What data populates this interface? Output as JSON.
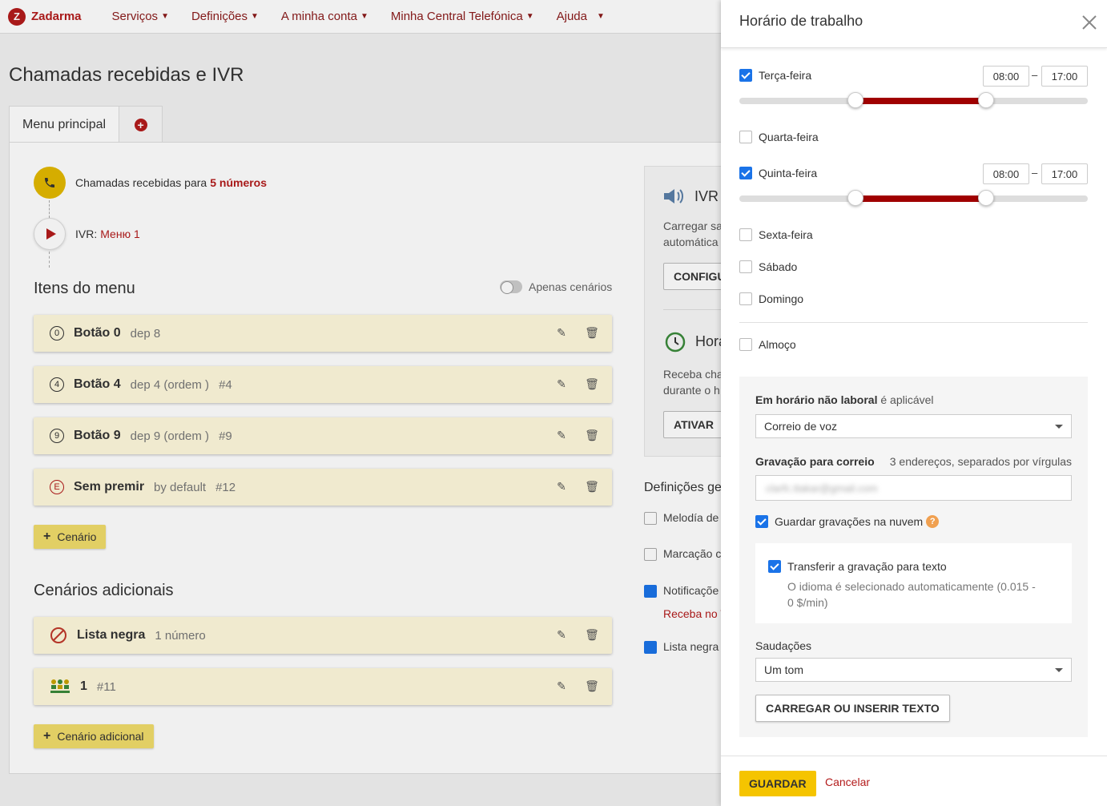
{
  "topbar": {
    "brand": "Zadarma",
    "nav": [
      "Serviços",
      "Definições",
      "A minha conta",
      "Minha Central Telefónica",
      "Ajuda"
    ]
  },
  "page": {
    "title": "Chamadas recebidas e IVR",
    "tab_main": "Menu principal"
  },
  "flow": {
    "incoming_text": "Chamadas recebidas para",
    "incoming_link": "5 números",
    "ivr_label": "IVR:",
    "ivr_link": "Меню 1"
  },
  "menu_section": {
    "title": "Itens do menu",
    "toggle_label": "Apenas cenários",
    "items": [
      {
        "key": "0",
        "name": "Botão 0",
        "sub": "dep 8",
        "num": ""
      },
      {
        "key": "4",
        "name": "Botão 4",
        "sub": "dep 4 (ordem )",
        "num": "#4"
      },
      {
        "key": "9",
        "name": "Botão 9",
        "sub": "dep 9 (ordem )",
        "num": "#9"
      },
      {
        "key": "E",
        "name": "Sem premir",
        "sub": "by default",
        "num": "#12"
      }
    ],
    "add_button": "Cenário"
  },
  "scenarios_section": {
    "title": "Cenários adicionais",
    "items": [
      {
        "name": "Lista negra",
        "sub": "1 número"
      },
      {
        "name": "1",
        "sub": "#11"
      }
    ],
    "add_button": "Cenário adicional"
  },
  "right_card": {
    "ivr_title": "IVR",
    "ivr_text_1": "Carregar sa",
    "ivr_text_2": "automática",
    "ivr_button": "CONFIGU",
    "hours_title": "Hora",
    "hours_text_1": "Receba cha",
    "hours_text_2": "durante o h",
    "hours_button": "ATIVAR"
  },
  "general_settings": {
    "title": "Definições ge",
    "items": [
      {
        "label": "Melodía de",
        "checked": false
      },
      {
        "label": "Marcação c",
        "checked": false
      },
      {
        "label": "Notificaçõe",
        "checked": true
      },
      {
        "label": "Lista negra",
        "checked": true
      }
    ],
    "notify_link": "Receba no T"
  },
  "panel": {
    "title": "Horário de trabalho",
    "days": [
      {
        "name": "Terça-feira",
        "checked": true,
        "start": "08:00",
        "end": "17:00",
        "start_frac": 0.333,
        "end_frac": 0.708
      },
      {
        "name": "Quarta-feira",
        "checked": false
      },
      {
        "name": "Quinta-feira",
        "checked": true,
        "start": "08:00",
        "end": "17:00",
        "start_frac": 0.333,
        "end_frac": 0.708
      },
      {
        "name": "Sexta-feira",
        "checked": false
      },
      {
        "name": "Sábado",
        "checked": false
      },
      {
        "name": "Domingo",
        "checked": false
      }
    ],
    "time_separator": "–",
    "lunch_label": "Almoço",
    "lunch_checked": false,
    "offhours_label_bold": "Em horário não laboral",
    "offhours_label_rest": "é aplicável",
    "offhours_value": "Correio de voz",
    "voicemail_label": "Gravação para correio",
    "voicemail_hint": "3 endereços, separados por vírgulas",
    "voicemail_value": "clarfc.ttakar@gmail.com",
    "cloud_label": "Guardar gravações na nuvem",
    "cloud_checked": true,
    "transcribe_label": "Transferir a gravação para texto",
    "transcribe_checked": true,
    "transcribe_note_1": "O idioma é selecionado automaticamente (0.015 -",
    "transcribe_note_2": "0 $/min)",
    "greetings_label": "Saudações",
    "greetings_value": "Um tom",
    "upload_button": "CARREGAR OU INSERIR TEXTO",
    "save_button": "GUARDAR",
    "cancel_button": "Cancelar"
  },
  "colors": {
    "brand": "#b31b1b",
    "accent_yellow": "#f5c400",
    "slider_fill": "#a00000",
    "checkbox": "#1a73e8"
  }
}
